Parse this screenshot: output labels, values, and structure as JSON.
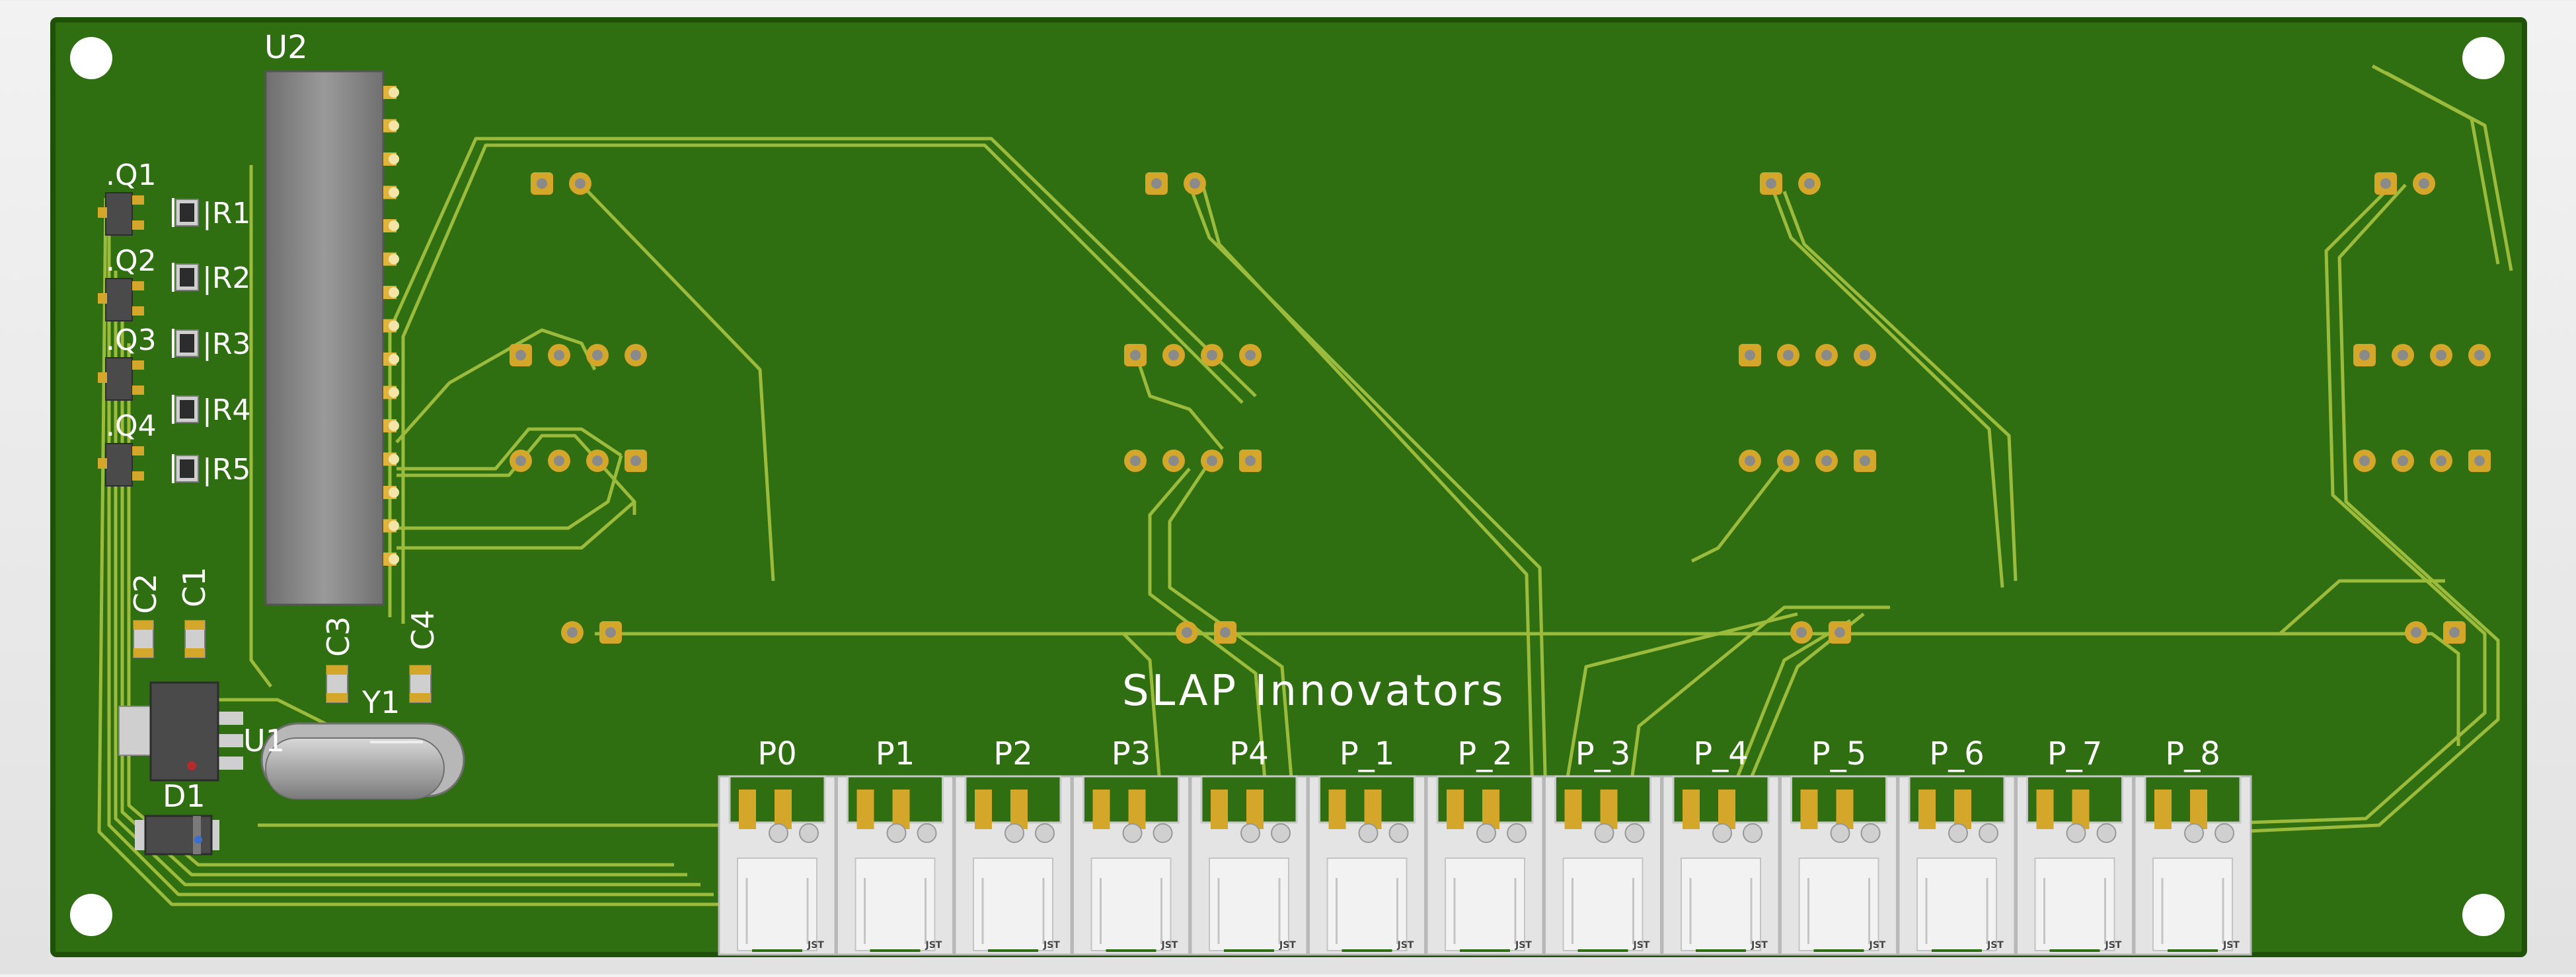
{
  "board": {
    "brand_text": "SLAP Innovators",
    "colors": {
      "board": "#2f6f12",
      "board_edge": "#1f5109",
      "trace": "#9cbb3c",
      "silk": "#ffffff",
      "pad": "#d4a62a",
      "ic_body": "#8a8a8a",
      "connector": "#e4e4e4"
    }
  },
  "components": {
    "u2": "U2",
    "u1": "U1",
    "y1": "Y1",
    "d1": "D1",
    "c1": "C1",
    "c2": "C2",
    "c3": "C3",
    "c4": "C4",
    "q": [
      "Q1",
      "Q2",
      "Q3",
      "Q4"
    ],
    "r": [
      "R1",
      "R2",
      "R3",
      "R4",
      "R5"
    ]
  },
  "connectors": {
    "labels": [
      "P0",
      "P1",
      "P2",
      "P3",
      "P4",
      "P_1",
      "P_2",
      "P_3",
      "P_4",
      "P_5",
      "P_6",
      "P_7",
      "P_8"
    ],
    "marking": "JST"
  }
}
